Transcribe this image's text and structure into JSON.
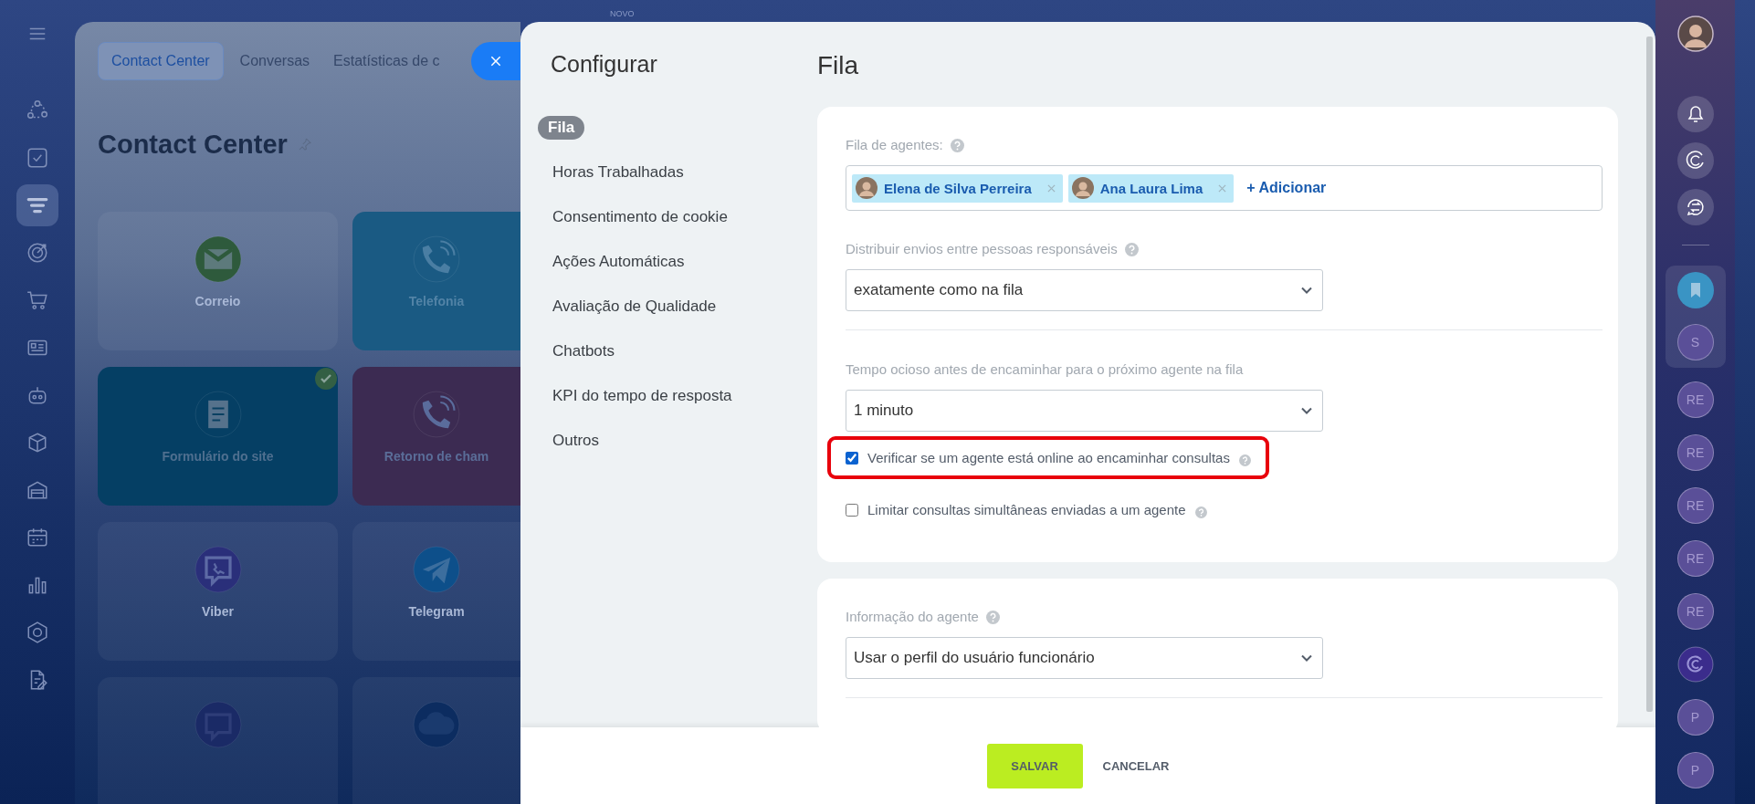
{
  "top_bar": {
    "badge": "NOVO"
  },
  "left_nav": [
    {
      "selected": false
    },
    {
      "selected": false
    },
    {
      "selected": true
    },
    {
      "selected": false
    },
    {
      "selected": false
    },
    {
      "selected": false
    },
    {
      "selected": false
    },
    {
      "selected": false
    },
    {
      "selected": false
    },
    {
      "selected": false
    },
    {
      "selected": false
    },
    {
      "selected": false
    },
    {
      "selected": false
    }
  ],
  "background_app": {
    "tabs": [
      {
        "label": "Contact Center",
        "selected": true
      },
      {
        "label": "Conversas",
        "selected": false
      },
      {
        "label": "Estatísticas de c",
        "selected": false
      }
    ],
    "title": "Contact Center",
    "tiles": [
      {
        "label": "Correio",
        "kind": "mail",
        "connected": false
      },
      {
        "label": "Telefonia",
        "kind": "phone",
        "connected": false
      },
      {
        "label": "Formulário do site",
        "kind": "form",
        "connected": true
      },
      {
        "label": "Retorno de cham",
        "kind": "callback",
        "connected": false
      },
      {
        "label": "Viber",
        "kind": "viber",
        "connected": false
      },
      {
        "label": "Telegram",
        "kind": "telegram",
        "connected": false
      },
      {
        "kind": "chat",
        "connected": false
      },
      {
        "kind": "cloud",
        "connected": false
      }
    ]
  },
  "settings_panel": {
    "title": "Configurar",
    "menu": [
      {
        "label": "Fila",
        "selected": true
      },
      {
        "label": "Horas Trabalhadas",
        "selected": false
      },
      {
        "label": "Consentimento de cookie",
        "selected": false
      },
      {
        "label": "Ações Automáticas",
        "selected": false
      },
      {
        "label": "Avaliação de Qualidade",
        "selected": false
      },
      {
        "label": "Chatbots",
        "selected": false
      },
      {
        "label": "KPI do tempo de resposta",
        "selected": false
      },
      {
        "label": "Outros",
        "selected": false
      }
    ],
    "heading": "Fila",
    "queue_section": {
      "agents_label": "Fila de agentes:",
      "agents": [
        {
          "name": "Elena de Silva Perreira"
        },
        {
          "name": "Ana Laura Lima"
        }
      ],
      "add_link": "+ Adicionar",
      "distribution": {
        "label": "Distribuir envios entre pessoas responsáveis",
        "value": "exatamente como na fila"
      },
      "idle_time": {
        "label": "Tempo ocioso antes de encaminhar para o próximo agente na fila",
        "value": "1 minuto"
      },
      "options": [
        {
          "label": "Verificar se um agente está online ao encaminhar consultas",
          "checked": true,
          "highlighted": true
        },
        {
          "label": "Limitar consultas simultâneas enviadas a um agente",
          "checked": false,
          "highlighted": false
        }
      ]
    },
    "agent_info_section": {
      "label": "Informação do agente",
      "value": "Usar o perfil do usuário funcionário"
    },
    "footer": {
      "save": "SALVAR",
      "cancel": "CANCELAR"
    }
  },
  "right_bar": {
    "pinned": [
      {
        "kind": "bookmark"
      },
      {
        "kind": "initials",
        "text": "S"
      }
    ],
    "chats": [
      {
        "kind": "initials",
        "text": "RE"
      },
      {
        "kind": "initials",
        "text": "RE"
      },
      {
        "kind": "initials",
        "text": "RE"
      },
      {
        "kind": "initials",
        "text": "RE"
      },
      {
        "kind": "initials",
        "text": "RE"
      },
      {
        "kind": "icon"
      },
      {
        "kind": "initials",
        "text": "P"
      },
      {
        "kind": "initials",
        "text": "P"
      }
    ]
  }
}
